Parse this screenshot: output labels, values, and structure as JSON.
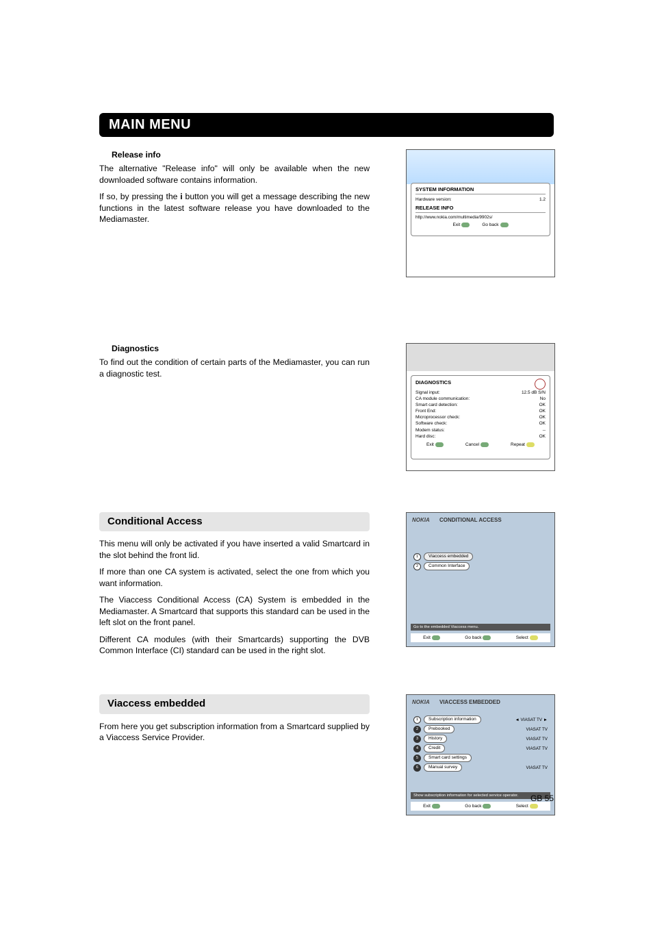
{
  "page_title": "MAIN MENU",
  "release_info": {
    "heading": "Release info",
    "p1": "The alternative \"Release info\" will only be available when the new downloaded software contains information.",
    "p2_a": "If so, by pressing the ",
    "p2_b": "i",
    "p2_c": " button you will get a message describing the new functions in the latest software release you have downloaded to the Mediamaster."
  },
  "diagnostics": {
    "heading": "Diagnostics",
    "p1": "To find out the condition of certain parts of the Mediamaster, you can run a diagnostic test."
  },
  "conditional_access": {
    "heading": "Conditional Access",
    "p1": "This menu will only be activated if you have inserted a valid Smartcard in the slot behind the front lid.",
    "p2": "If more than one CA system is activated, select the one from which you want information.",
    "p3": "The Viaccess Conditional Access (CA) System is embedded in the Mediamaster. A Smartcard that supports this standard can be used in the left slot on the front panel.",
    "p4": "Different CA modules (with their Smartcards) supporting the DVB Common Interface (CI) standard can be used in the right slot."
  },
  "viaccess_embedded": {
    "heading": "Viaccess embedded",
    "p1": "From here you get subscription information from a Smartcard supplied by a Viaccess Service Provider."
  },
  "screen1": {
    "title": "SYSTEM INFORMATION",
    "hw_label": "Hardware version:",
    "hw_value": "1.2",
    "rel_title": "RELEASE INFO",
    "url": "http://www.nokia.com/multimedia/9902s/",
    "btn_exit": "Exit",
    "btn_back": "Go back"
  },
  "screen2": {
    "title": "DIAGNOSTICS",
    "rows": [
      {
        "k": "Signal input:",
        "v": "12.5 dB S/N"
      },
      {
        "k": "CA module communication:",
        "v": "No"
      },
      {
        "k": "Smart card detection:",
        "v": "OK"
      },
      {
        "k": "Front End:",
        "v": "OK"
      },
      {
        "k": "Microprocessor check:",
        "v": "OK"
      },
      {
        "k": "Software check:",
        "v": "OK"
      },
      {
        "k": "Modem status:",
        "v": "--"
      },
      {
        "k": "Hard disc:",
        "v": "OK"
      }
    ],
    "btn_exit": "Exit",
    "btn_cancel": "Cancel",
    "btn_repeat": "Repeat"
  },
  "screen3": {
    "brand": "NOKIA",
    "title": "CONDITIONAL ACCESS",
    "items": [
      {
        "n": "1",
        "label": "Viaccess embedded",
        "sel": true
      },
      {
        "n": "2",
        "label": "Common Interface",
        "sel": false
      }
    ],
    "hint": "Go to the embedded Viaccess menu.",
    "btn_exit": "Exit",
    "btn_back": "Go back",
    "btn_select": "Select"
  },
  "screen4": {
    "brand": "NOKIA",
    "title": "VIACCESS EMBEDDED",
    "items": [
      {
        "n": "1",
        "label": "Subscription information",
        "val": "VIASAT TV",
        "arrows": true,
        "sel": true
      },
      {
        "n": "2",
        "label": "Prebooked",
        "val": "VIASAT TV"
      },
      {
        "n": "3",
        "label": "History",
        "val": "VIASAT TV"
      },
      {
        "n": "4",
        "label": "Credit",
        "val": "VIASAT TV"
      },
      {
        "n": "5",
        "label": "Smart card settings",
        "val": ""
      },
      {
        "n": "6",
        "label": "Manual survey",
        "val": "VIASAT TV"
      }
    ],
    "hint": "Show subscription information for selected service operator.",
    "btn_exit": "Exit",
    "btn_back": "Go back",
    "btn_select": "Select"
  },
  "page_number": "GB 55"
}
